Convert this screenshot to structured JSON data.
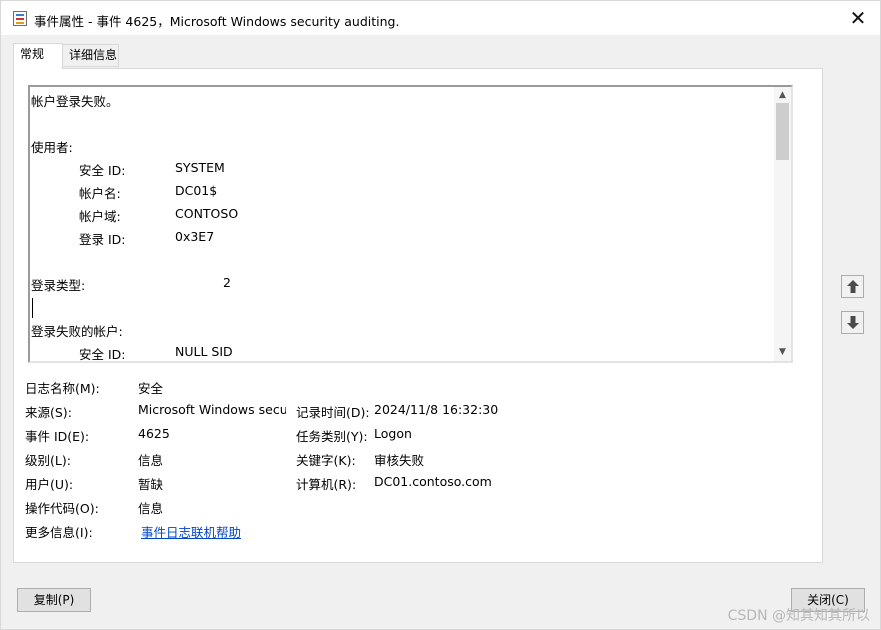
{
  "window": {
    "title": "事件属性 - 事件 4625，Microsoft Windows security auditing.",
    "close_glyph": "✕"
  },
  "tabs": [
    {
      "label": "常规",
      "active": true
    },
    {
      "label": "详细信息",
      "active": false
    }
  ],
  "description": {
    "heading": "帐户登录失败。",
    "subject_header": "使用者:",
    "subject": [
      {
        "key": "安全 ID:",
        "value": "SYSTEM"
      },
      {
        "key": "帐户名:",
        "value": "DC01$"
      },
      {
        "key": "帐户域:",
        "value": "CONTOSO"
      },
      {
        "key": "登录 ID:",
        "value": "0x3E7"
      }
    ],
    "logon_type_label": "登录类型:",
    "logon_type_value": "2",
    "failed_account_header": "登录失败的帐户:",
    "failed_account": [
      {
        "key": "安全 ID:",
        "value": "NULL SID"
      }
    ]
  },
  "fields": {
    "log_name_label": "日志名称(M):",
    "log_name": "安全",
    "source_label": "来源(S):",
    "source": "Microsoft Windows security auditing.",
    "logged_label": "记录时间(D):",
    "logged": "2024/11/8 16:32:30",
    "event_id_label": "事件 ID(E):",
    "event_id": "4625",
    "task_category_label": "任务类别(Y):",
    "task_category": "Logon",
    "level_label": "级别(L):",
    "level": "信息",
    "keywords_label": "关键字(K):",
    "keywords": "审核失败",
    "user_label": "用户(U):",
    "user": "暂缺",
    "computer_label": "计算机(R):",
    "computer": "DC01.contoso.com",
    "opcode_label": "操作代码(O):",
    "opcode": "信息",
    "more_info_label": "更多信息(I):",
    "more_info_link": "事件日志联机帮助"
  },
  "buttons": {
    "copy": "复制(P)",
    "close": "关闭(C)"
  },
  "watermark": "CSDN @知其知其所以",
  "icons": {
    "title": "event-viewer-icon",
    "previous": "arrow-up-icon",
    "next": "arrow-down-icon"
  }
}
